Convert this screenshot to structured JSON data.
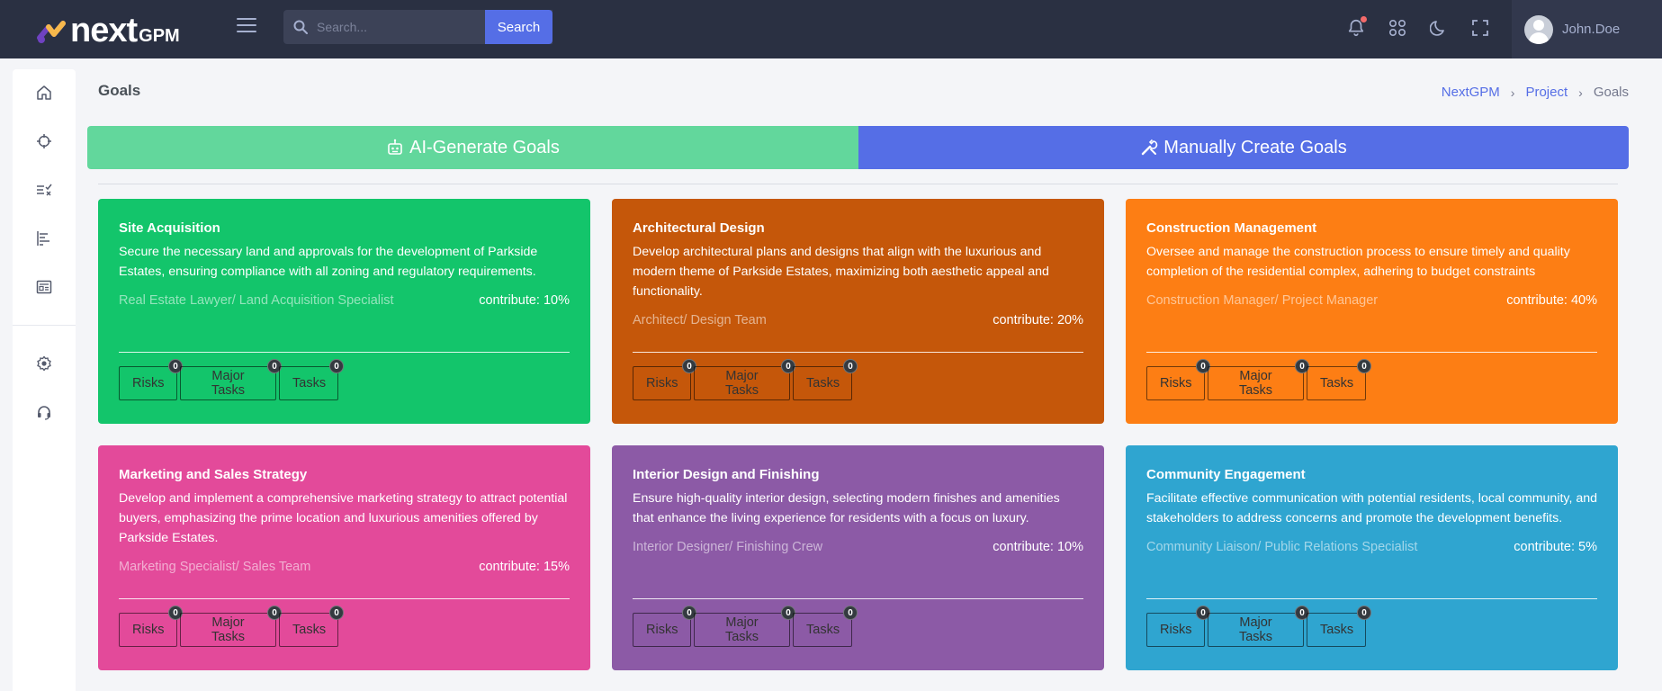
{
  "app": {
    "logo_text": "next",
    "logo_sub": "GPM"
  },
  "header": {
    "search_placeholder": "Search...",
    "search_button": "Search",
    "user_name": "John.Doe"
  },
  "page": {
    "title": "Goals",
    "breadcrumb": [
      "NextGPM",
      "Project",
      "Goals"
    ]
  },
  "actions": {
    "ai_generate": "AI-Generate Goals",
    "manual_create": "Manually Create Goals"
  },
  "colors": {
    "topbar": "#2a3042",
    "primary": "#556ee6",
    "ai_button": "#62d79c"
  },
  "goals": [
    {
      "title": "Site Acquisition",
      "description": "Secure the necessary land and approvals for the development of Parkside Estates, ensuring compliance with all zoning and regulatory requirements.",
      "role": "Real Estate Lawyer/ Land Acquisition Specialist",
      "contribute": "contribute: 10%",
      "color": "#13c56b",
      "counts": {
        "risks": "0",
        "major_tasks": "0",
        "tasks": "0"
      }
    },
    {
      "title": "Architectural Design",
      "description": "Develop architectural plans and designs that align with the luxurious and modern theme of Parkside Estates, maximizing both aesthetic appeal and functionality.",
      "role": "Architect/ Design Team",
      "contribute": "contribute: 20%",
      "color": "#c5570a",
      "counts": {
        "risks": "0",
        "major_tasks": "0",
        "tasks": "0"
      }
    },
    {
      "title": "Construction Management",
      "description": "Oversee and manage the construction process to ensure timely and quality completion of the residential complex, adhering to budget constraints",
      "role": "Construction Manager/ Project Manager",
      "contribute": "contribute: 40%",
      "color": "#fd7e14",
      "counts": {
        "risks": "0",
        "major_tasks": "0",
        "tasks": "0"
      }
    },
    {
      "title": "Marketing and Sales Strategy",
      "description": "Develop and implement a comprehensive marketing strategy to attract potential buyers, emphasizing the prime location and luxurious amenities offered by Parkside Estates.",
      "role": "Marketing Specialist/ Sales Team",
      "contribute": "contribute: 15%",
      "color": "#e34a9a",
      "counts": {
        "risks": "0",
        "major_tasks": "0",
        "tasks": "0"
      }
    },
    {
      "title": "Interior Design and Finishing",
      "description": "Ensure high-quality interior design, selecting modern finishes and amenities that enhance the living experience for residents with a focus on luxury.",
      "role": "Interior Designer/ Finishing Crew",
      "contribute": "contribute: 10%",
      "color": "#8c5aa6",
      "counts": {
        "risks": "0",
        "major_tasks": "0",
        "tasks": "0"
      }
    },
    {
      "title": "Community Engagement",
      "description": "Facilitate effective communication with potential residents, local community, and stakeholders to address concerns and promote the development benefits.",
      "role": "Community Liaison/ Public Relations Specialist",
      "contribute": "contribute: 5%",
      "color": "#2fa5d0",
      "counts": {
        "risks": "0",
        "major_tasks": "0",
        "tasks": "0"
      }
    }
  ],
  "chip_labels": {
    "risks": "Risks",
    "major_tasks": "Major Tasks",
    "tasks": "Tasks"
  },
  "icons": {
    "sidebar": [
      "home-icon",
      "crosshair-icon",
      "checklist-icon",
      "gantt-icon",
      "report-icon",
      "gear-icon",
      "headset-icon"
    ],
    "topbar": [
      "bell-icon",
      "apps-icon",
      "moon-icon",
      "fullscreen-icon"
    ]
  }
}
